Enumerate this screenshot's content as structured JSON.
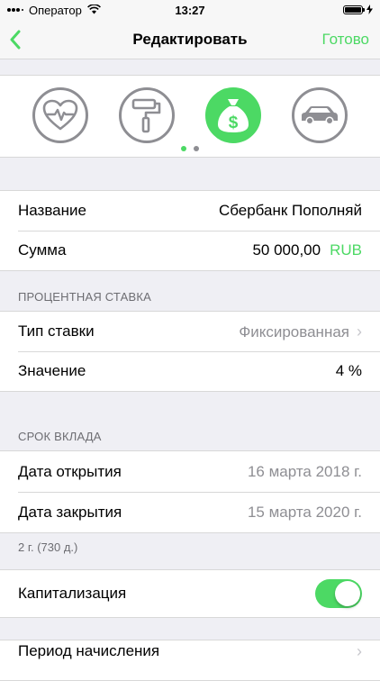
{
  "status_bar": {
    "carrier": "Оператор",
    "time": "13:27"
  },
  "nav": {
    "title": "Редактировать",
    "done_label": "Готово"
  },
  "categories": [
    {
      "icon": "heart-pulse-icon",
      "selected": false
    },
    {
      "icon": "paint-roller-icon",
      "selected": false
    },
    {
      "icon": "money-bag-icon",
      "selected": true
    },
    {
      "icon": "car-icon",
      "selected": false
    }
  ],
  "pager": {
    "pages": 2,
    "active": 0
  },
  "main": {
    "name_label": "Название",
    "name_value": "Сбербанк Пополняй",
    "amount_label": "Сумма",
    "amount_value": "50 000,00",
    "currency": "RUB"
  },
  "rate_section": {
    "header": "ПРОЦЕНТНАЯ СТАВКА",
    "type_label": "Тип ставки",
    "type_value": "Фиксированная",
    "value_label": "Значение",
    "value_value": "4 %"
  },
  "term_section": {
    "header": "СРОК ВКЛАДА",
    "open_label": "Дата открытия",
    "open_value": "16 марта 2018 г.",
    "close_label": "Дата закрытия",
    "close_value": "15 марта 2020 г.",
    "footnote": "2 г. (730 д.)"
  },
  "capitalization": {
    "label": "Капитализация",
    "enabled": true
  },
  "accrual": {
    "label": "Период начисления"
  },
  "colors": {
    "accent": "#4cd964",
    "inactive": "#8e8e93",
    "background": "#efeff4"
  }
}
